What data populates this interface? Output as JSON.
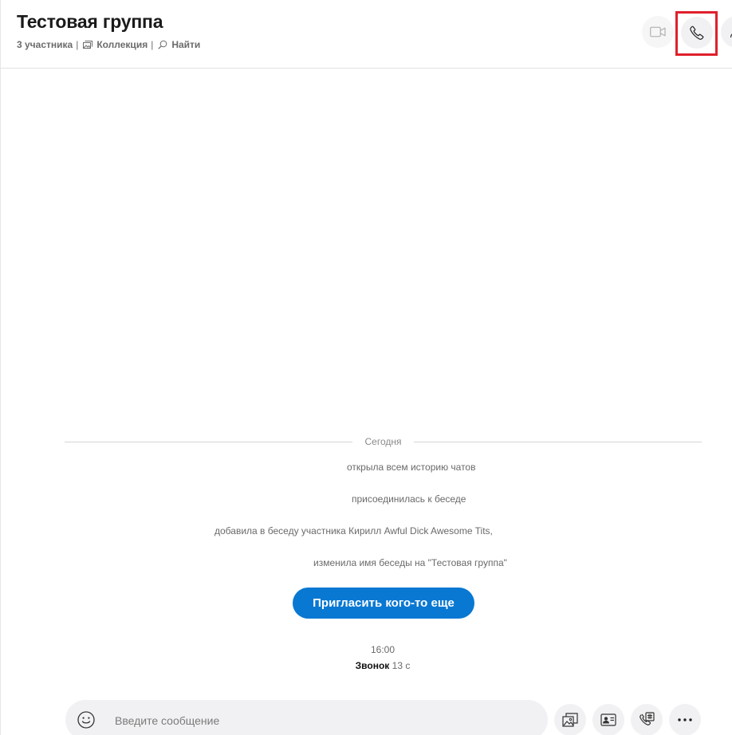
{
  "header": {
    "title": "Тестовая группа",
    "participants": "3 участника",
    "separator": "|",
    "collection_label": "Коллекция",
    "find_label": "Найти"
  },
  "icons": {
    "video": "video-camera-icon",
    "call": "phone-icon",
    "more": "add-people-icon",
    "collection": "gallery-icon",
    "search": "search-icon",
    "emoji": "emoji-icon",
    "image": "image-icon",
    "contact": "contact-card-icon",
    "schedule": "schedule-call-icon",
    "more_options": "more-icon"
  },
  "timeline": {
    "date_label": "Сегодня",
    "events": [
      "открыла всем историю чатов",
      "присоединилась к беседе",
      "добавила в беседу участника Кирилл Awful Dick Awesome Tits,",
      "изменила имя беседы на \"Тестовая группа\""
    ],
    "invite_label": "Пригласить кого-то еще",
    "call_time": "16:00",
    "call_label": "Звонок",
    "call_duration": "13 с"
  },
  "composer": {
    "placeholder": "Введите сообщение"
  },
  "colors": {
    "accent": "#0878d3",
    "highlight": "#e0202c",
    "surface": "#f1f1f3"
  }
}
